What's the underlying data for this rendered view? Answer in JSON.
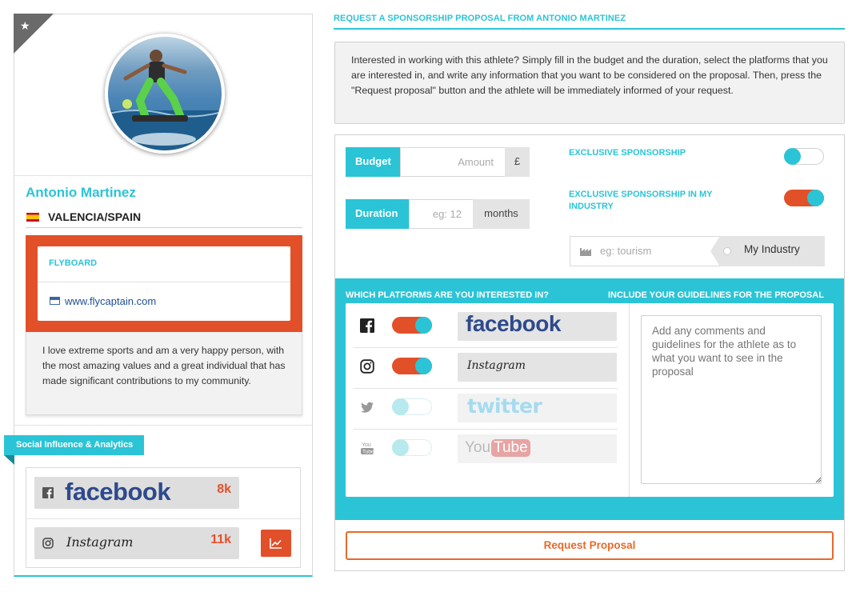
{
  "profile": {
    "name": "Antonio Martinez",
    "location": "VALENCIA/SPAIN",
    "sport": "FLYBOARD",
    "website": "www.flycaptain.com",
    "bio": "I love extreme sports and am a very happy person, with the most amazing values and a great individual that has made significant contributions to my community."
  },
  "analytics": {
    "tag_label": "Social Influence & Analytics",
    "networks": [
      {
        "name": "facebook",
        "icon": "facebook-icon",
        "followers": "8k"
      },
      {
        "name": "Instagram",
        "icon": "instagram-icon",
        "followers": "11k"
      }
    ],
    "chart_button_icon": "line-chart-icon"
  },
  "request": {
    "title": "REQUEST A SPONSORSHIP PROPOSAL FROM ANTONIO MARTINEZ",
    "intro": "Interested in working with this athlete? Simply fill in the budget and the duration, select the platforms that you are interested in, and write any information that you want to be considered on the proposal. Then, press the \"Request proposal\" button and the athlete will be immediately informed of your request.",
    "budget": {
      "label": "Budget",
      "placeholder": "Amount",
      "currency": "£"
    },
    "duration": {
      "label": "Duration",
      "placeholder": "eg: 12",
      "unit": "months"
    },
    "exclusive_sponsorship": {
      "label": "EXCLUSIVE SPONSORSHIP",
      "on": false
    },
    "exclusive_industry": {
      "label": "EXCLUSIVE SPONSORSHIP IN MY INDUSTRY",
      "on": true
    },
    "industry": {
      "placeholder": "eg: tourism",
      "addon": "My Industry",
      "icon": "industry-icon"
    },
    "platforms_heading": "WHICH PLATFORMS ARE YOU INTERESTED IN?",
    "guidelines_heading": "INCLUDE YOUR GUIDELINES FOR THE PROPOSAL",
    "guidelines_placeholder": "Add any comments and guidelines for the athlete as to what you want to see in the proposal",
    "platforms": [
      {
        "name": "facebook",
        "logo_text": "facebook",
        "icon": "facebook-icon",
        "selected": true
      },
      {
        "name": "instagram",
        "logo_text": "Instagram",
        "icon": "instagram-icon",
        "selected": true
      },
      {
        "name": "twitter",
        "logo_text": "twitter",
        "icon": "twitter-icon",
        "selected": false
      },
      {
        "name": "youtube",
        "logo_text_a": "You",
        "logo_text_b": "Tube",
        "icon": "youtube-icon",
        "selected": false
      }
    ],
    "submit_label": "Request Proposal"
  },
  "colors": {
    "accent": "#2bc4d6",
    "orange": "#e2502a",
    "button_border": "#e66a2c",
    "facebook_blue": "#2e4a8c"
  }
}
